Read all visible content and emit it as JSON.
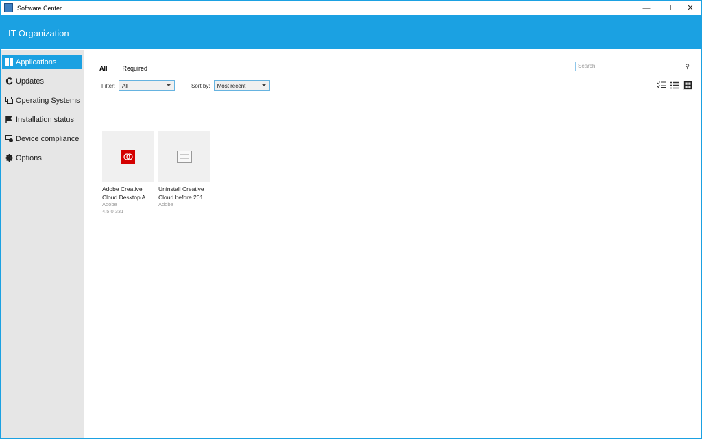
{
  "window": {
    "title": "Software Center"
  },
  "header": {
    "title": "IT Organization"
  },
  "sidebar": {
    "items": [
      {
        "label": "Applications",
        "icon": "apps-icon",
        "active": true
      },
      {
        "label": "Updates",
        "icon": "refresh-icon"
      },
      {
        "label": "Operating Systems",
        "icon": "windows-stack-icon"
      },
      {
        "label": "Installation status",
        "icon": "flag-icon"
      },
      {
        "label": "Device compliance",
        "icon": "device-check-icon"
      },
      {
        "label": "Options",
        "icon": "gear-icon"
      }
    ]
  },
  "main": {
    "tabs": [
      {
        "label": "All",
        "active": true
      },
      {
        "label": "Required"
      }
    ],
    "filter": {
      "label": "Filter:",
      "value": "All"
    },
    "sort": {
      "label": "Sort by:",
      "value": "Most recent"
    },
    "search": {
      "placeholder": "Search"
    },
    "view_modes": [
      "checklist-view",
      "list-view",
      "tile-view"
    ],
    "apps": [
      {
        "name1": "Adobe Creative",
        "name2": "Cloud Desktop A...",
        "publisher": "Adobe",
        "version": "4.5.0.331",
        "icon": "adobe-cc-icon"
      },
      {
        "name1": "Uninstall Creative",
        "name2": "Cloud before 201...",
        "publisher": "Adobe",
        "version": "",
        "icon": "generic-app-icon"
      }
    ]
  },
  "colors": {
    "accent": "#1ba1e2",
    "sidebar": "#e6e6e6",
    "adobe_red": "#d40000"
  }
}
